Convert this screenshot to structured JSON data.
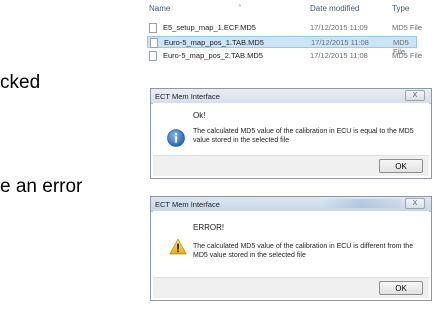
{
  "background_text": {
    "line1": "cked",
    "line2": "e an error"
  },
  "explorer": {
    "columns": {
      "name": "Name",
      "date": "Date modified",
      "type": "Type"
    },
    "files": [
      {
        "name": "E5_setup_map_1.ECF.MD5",
        "date": "17/12/2015 11:09",
        "type": "MD5 File",
        "selected": false
      },
      {
        "name": "Euro-5_map_pos_1.TAB.MD5",
        "date": "17/12/2015 11:08",
        "type": "MD5 File",
        "selected": true
      },
      {
        "name": "Euro-5_map_pos_2.TAB.MD5",
        "date": "17/12/2015 11:08",
        "type": "MD5 File",
        "selected": false
      }
    ]
  },
  "dialog_ok": {
    "title": "ECT Mem Interface",
    "close_label": "X",
    "icon": "info-icon",
    "headline": "Ok!",
    "message": "The calculated MD5 value of the calibration in ECU is equal to the MD5 value stored in the selected file",
    "button_label": "OK"
  },
  "dialog_error": {
    "title": "ECT Mem Interface",
    "close_label": "X",
    "icon": "warning-icon",
    "headline": "ERROR!",
    "message": "The calculated MD5 value of the calibration in ECU is different from the MD5 value stored in the selected file",
    "button_label": "OK"
  },
  "colors": {
    "selection": "#cce4f7",
    "info_blue": "#2a72c9",
    "warning_yellow": "#f3c623"
  }
}
